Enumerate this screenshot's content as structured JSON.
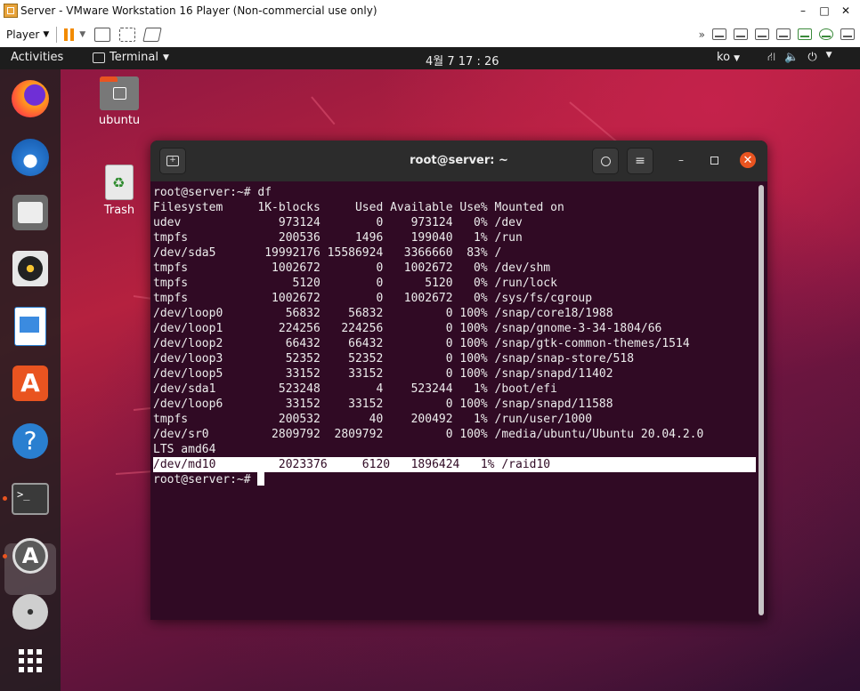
{
  "vmware": {
    "title": "Server - VMware Workstation 16 Player (Non-commercial use only)",
    "window_controls": [
      "–",
      "□",
      "✕"
    ],
    "player_menu_label": "Player",
    "right_toolbar_icons": [
      "chevrons-right-icon",
      "hdd-icon",
      "hdd-icon",
      "hdd-icon",
      "hdd-icon",
      "network-icon",
      "cdrom-icon",
      "devices-icon"
    ]
  },
  "topbar": {
    "activities": "Activities",
    "app_menu": "Terminal",
    "clock": "4월 7  17 : 26",
    "input_method": "ko",
    "tray_icons": [
      "network-icon",
      "volume-icon",
      "power-icon"
    ]
  },
  "desktop": {
    "icons": [
      {
        "label": "ubuntu",
        "icon": "home-folder-icon"
      },
      {
        "label": "Trash",
        "icon": "trash-icon"
      }
    ]
  },
  "dock": {
    "items": [
      "firefox-icon",
      "thunderbird-icon",
      "files-icon",
      "rhythmbox-icon",
      "libreoffice-writer-icon",
      "ubuntu-software-icon",
      "help-icon",
      "terminal-icon",
      "software-updater-icon",
      "dvd-icon",
      "show-applications-icon"
    ],
    "colors": {
      "active_dot": "#e95420"
    }
  },
  "terminal": {
    "title": "root@server: ~",
    "prompt_line": "root@server:~# df",
    "lines": [
      "Filesystem     1K-blocks     Used Available Use% Mounted on",
      "udev              973124        0    973124   0% /dev",
      "tmpfs             200536     1496    199040   1% /run",
      "/dev/sda5       19992176 15586924   3366660  83% /",
      "tmpfs            1002672        0   1002672   0% /dev/shm",
      "tmpfs               5120        0      5120   0% /run/lock",
      "tmpfs            1002672        0   1002672   0% /sys/fs/cgroup",
      "/dev/loop0         56832    56832         0 100% /snap/core18/1988",
      "/dev/loop1        224256   224256         0 100% /snap/gnome-3-34-1804/66",
      "/dev/loop2         66432    66432         0 100% /snap/gtk-common-themes/1514",
      "/dev/loop3         52352    52352         0 100% /snap/snap-store/518",
      "/dev/loop5         33152    33152         0 100% /snap/snapd/11402",
      "/dev/sda1         523248        4    523244   1% /boot/efi",
      "/dev/loop6         33152    33152         0 100% /snap/snapd/11588",
      "tmpfs             200532       40    200492   1% /run/user/1000",
      "/dev/sr0         2809792  2809792         0 100% /media/ubuntu/Ubuntu 20.04.2.0",
      "LTS amd64"
    ],
    "highlight_line": "/dev/md10         2023376     6120   1896424   1% /raid10",
    "final_prompt": "root@server:~# ",
    "colors": {
      "background": "#300a24",
      "header": "#2c2c2c",
      "close": "#e95420"
    }
  }
}
